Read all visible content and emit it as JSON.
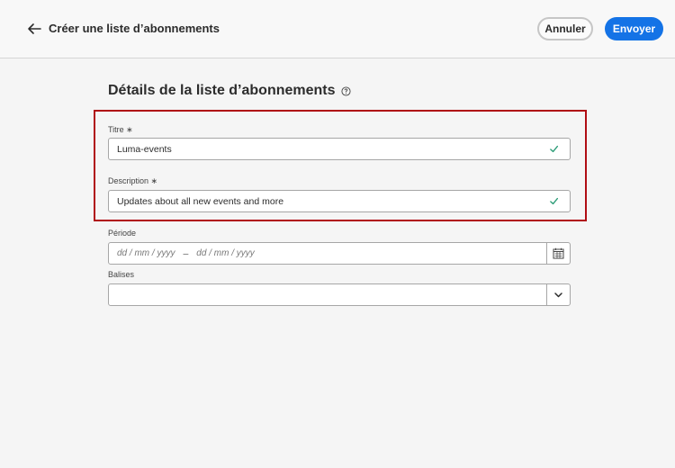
{
  "header": {
    "title": "Créer une liste d’abonnements",
    "cancel_label": "Annuler",
    "submit_label": "Envoyer"
  },
  "form": {
    "section_title": "Détails de la liste d’abonnements",
    "title_field": {
      "label": "Titre ∗",
      "value": "Luma-events"
    },
    "description_field": {
      "label": "Description ∗",
      "value": "Updates about all new events and more"
    },
    "period_field": {
      "label": "Période",
      "start_placeholder": "dd / mm / yyyy",
      "separator": "–",
      "end_placeholder": "dd / mm / yyyy"
    },
    "tags_field": {
      "label": "Balises",
      "value": ""
    }
  },
  "icons": {
    "back": "arrow-left-icon",
    "help": "help-icon",
    "valid": "checkmark-icon",
    "calendar": "calendar-icon",
    "dropdown": "chevron-down-icon"
  },
  "colors": {
    "accent": "#1473e6",
    "valid": "#2d9d78",
    "highlight": "#b00d14"
  }
}
